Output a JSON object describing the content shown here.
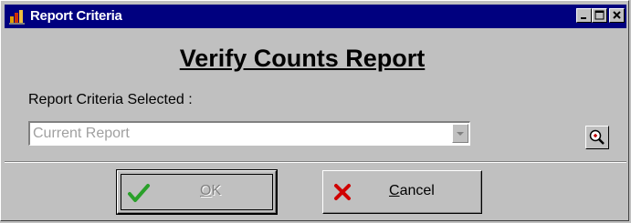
{
  "window": {
    "title": "Report Criteria",
    "title_bar_color": "#00007f",
    "controls": [
      "minimize-icon",
      "maximize-icon",
      "close-icon"
    ]
  },
  "report": {
    "heading": "Verify Counts Report",
    "criteria_label": "Report Criteria Selected :"
  },
  "criteria_select": {
    "value": "Current Report",
    "disabled": true
  },
  "buttons": {
    "ok": {
      "mnemonic": "O",
      "rest": "K",
      "icon": "checkmark-icon",
      "enabled": false
    },
    "cancel": {
      "mnemonic": "C",
      "rest": "ancel",
      "icon": "x-icon",
      "enabled": true
    }
  },
  "icons": {
    "zoom": "magnifier-icon",
    "app": "report-app-icon"
  }
}
